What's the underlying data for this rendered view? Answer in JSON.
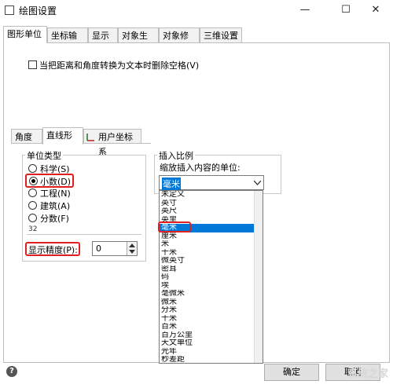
{
  "window": {
    "title": "绘图设置",
    "minimize": "—",
    "maximize": "☐",
    "close": "✕"
  },
  "tabs": [
    "图形单位",
    "坐标输入",
    "显示",
    "对象生成",
    "对象修改",
    "三维设置"
  ],
  "checkbox_label": "当把距离和角度转换为文本时删除空格(V)",
  "subtabs": [
    "角度",
    "直线形",
    "用户坐标系"
  ],
  "unit_type": {
    "legend": "单位类型",
    "options": [
      "科学(S)",
      "小数(D)",
      "工程(N)",
      "建筑(A)",
      "分数(F)"
    ],
    "selected_index": 1,
    "preview": "32",
    "precision_label": "显示精度(P):",
    "precision_value": "0"
  },
  "insert_scale": {
    "legend": "插入比例",
    "label": "缩放插入内容的单位:",
    "selected": "毫米",
    "options": [
      "未定义",
      "英寸",
      "英尺",
      "英里",
      "毫米",
      "厘米",
      "米",
      "千米",
      "微英寸",
      "密耳",
      "码",
      "埃",
      "毫微米",
      "微米",
      "分米",
      "十米",
      "百米",
      "百万公里",
      "天文单位",
      "光年",
      "秒差距"
    ],
    "selected_index": 4
  },
  "buttons": {
    "ok": "确定",
    "cancel": "取消"
  },
  "help": "?",
  "watermark": "系统之家"
}
